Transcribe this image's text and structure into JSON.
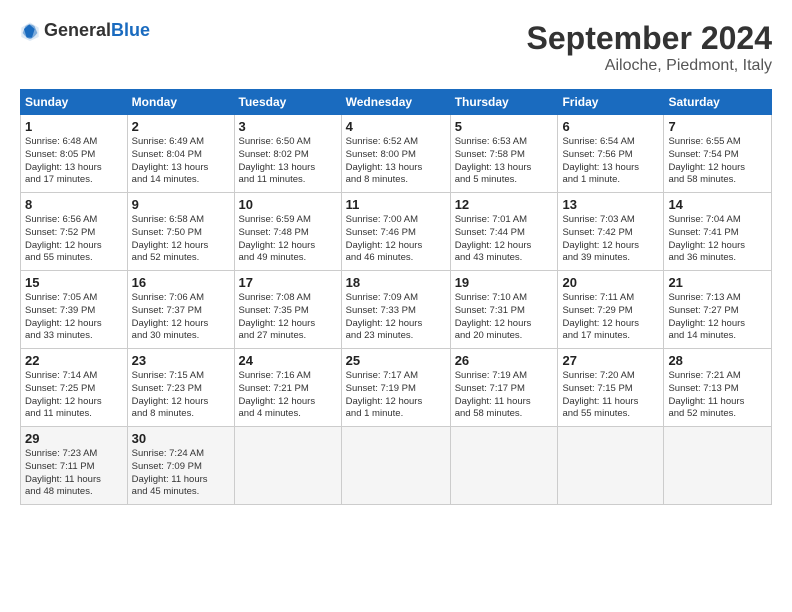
{
  "logo": {
    "general": "General",
    "blue": "Blue"
  },
  "title": "September 2024",
  "location": "Ailoche, Piedmont, Italy",
  "weekdays": [
    "Sunday",
    "Monday",
    "Tuesday",
    "Wednesday",
    "Thursday",
    "Friday",
    "Saturday"
  ],
  "weeks": [
    [
      {
        "day": "1",
        "info": "Sunrise: 6:48 AM\nSunset: 8:05 PM\nDaylight: 13 hours\nand 17 minutes."
      },
      {
        "day": "2",
        "info": "Sunrise: 6:49 AM\nSunset: 8:04 PM\nDaylight: 13 hours\nand 14 minutes."
      },
      {
        "day": "3",
        "info": "Sunrise: 6:50 AM\nSunset: 8:02 PM\nDaylight: 13 hours\nand 11 minutes."
      },
      {
        "day": "4",
        "info": "Sunrise: 6:52 AM\nSunset: 8:00 PM\nDaylight: 13 hours\nand 8 minutes."
      },
      {
        "day": "5",
        "info": "Sunrise: 6:53 AM\nSunset: 7:58 PM\nDaylight: 13 hours\nand 5 minutes."
      },
      {
        "day": "6",
        "info": "Sunrise: 6:54 AM\nSunset: 7:56 PM\nDaylight: 13 hours\nand 1 minute."
      },
      {
        "day": "7",
        "info": "Sunrise: 6:55 AM\nSunset: 7:54 PM\nDaylight: 12 hours\nand 58 minutes."
      }
    ],
    [
      {
        "day": "8",
        "info": "Sunrise: 6:56 AM\nSunset: 7:52 PM\nDaylight: 12 hours\nand 55 minutes."
      },
      {
        "day": "9",
        "info": "Sunrise: 6:58 AM\nSunset: 7:50 PM\nDaylight: 12 hours\nand 52 minutes."
      },
      {
        "day": "10",
        "info": "Sunrise: 6:59 AM\nSunset: 7:48 PM\nDaylight: 12 hours\nand 49 minutes."
      },
      {
        "day": "11",
        "info": "Sunrise: 7:00 AM\nSunset: 7:46 PM\nDaylight: 12 hours\nand 46 minutes."
      },
      {
        "day": "12",
        "info": "Sunrise: 7:01 AM\nSunset: 7:44 PM\nDaylight: 12 hours\nand 43 minutes."
      },
      {
        "day": "13",
        "info": "Sunrise: 7:03 AM\nSunset: 7:42 PM\nDaylight: 12 hours\nand 39 minutes."
      },
      {
        "day": "14",
        "info": "Sunrise: 7:04 AM\nSunset: 7:41 PM\nDaylight: 12 hours\nand 36 minutes."
      }
    ],
    [
      {
        "day": "15",
        "info": "Sunrise: 7:05 AM\nSunset: 7:39 PM\nDaylight: 12 hours\nand 33 minutes."
      },
      {
        "day": "16",
        "info": "Sunrise: 7:06 AM\nSunset: 7:37 PM\nDaylight: 12 hours\nand 30 minutes."
      },
      {
        "day": "17",
        "info": "Sunrise: 7:08 AM\nSunset: 7:35 PM\nDaylight: 12 hours\nand 27 minutes."
      },
      {
        "day": "18",
        "info": "Sunrise: 7:09 AM\nSunset: 7:33 PM\nDaylight: 12 hours\nand 23 minutes."
      },
      {
        "day": "19",
        "info": "Sunrise: 7:10 AM\nSunset: 7:31 PM\nDaylight: 12 hours\nand 20 minutes."
      },
      {
        "day": "20",
        "info": "Sunrise: 7:11 AM\nSunset: 7:29 PM\nDaylight: 12 hours\nand 17 minutes."
      },
      {
        "day": "21",
        "info": "Sunrise: 7:13 AM\nSunset: 7:27 PM\nDaylight: 12 hours\nand 14 minutes."
      }
    ],
    [
      {
        "day": "22",
        "info": "Sunrise: 7:14 AM\nSunset: 7:25 PM\nDaylight: 12 hours\nand 11 minutes."
      },
      {
        "day": "23",
        "info": "Sunrise: 7:15 AM\nSunset: 7:23 PM\nDaylight: 12 hours\nand 8 minutes."
      },
      {
        "day": "24",
        "info": "Sunrise: 7:16 AM\nSunset: 7:21 PM\nDaylight: 12 hours\nand 4 minutes."
      },
      {
        "day": "25",
        "info": "Sunrise: 7:17 AM\nSunset: 7:19 PM\nDaylight: 12 hours\nand 1 minute."
      },
      {
        "day": "26",
        "info": "Sunrise: 7:19 AM\nSunset: 7:17 PM\nDaylight: 11 hours\nand 58 minutes."
      },
      {
        "day": "27",
        "info": "Sunrise: 7:20 AM\nSunset: 7:15 PM\nDaylight: 11 hours\nand 55 minutes."
      },
      {
        "day": "28",
        "info": "Sunrise: 7:21 AM\nSunset: 7:13 PM\nDaylight: 11 hours\nand 52 minutes."
      }
    ],
    [
      {
        "day": "29",
        "info": "Sunrise: 7:23 AM\nSunset: 7:11 PM\nDaylight: 11 hours\nand 48 minutes."
      },
      {
        "day": "30",
        "info": "Sunrise: 7:24 AM\nSunset: 7:09 PM\nDaylight: 11 hours\nand 45 minutes."
      },
      {
        "day": "",
        "info": ""
      },
      {
        "day": "",
        "info": ""
      },
      {
        "day": "",
        "info": ""
      },
      {
        "day": "",
        "info": ""
      },
      {
        "day": "",
        "info": ""
      }
    ]
  ]
}
